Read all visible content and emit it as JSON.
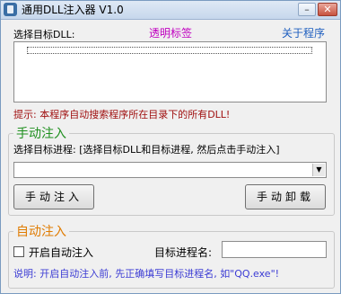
{
  "window": {
    "title": "通用DLL注入器 V1.0",
    "minimize_glyph": "–",
    "close_glyph": "✕"
  },
  "dll_section": {
    "label": "选择目标DLL:",
    "transparent_tag": "透明标签",
    "about_link": "关于程序",
    "hint": "提示: 本程序自动搜索程序所在目录下的所有DLL!"
  },
  "manual_inject": {
    "group_title": "手动注入",
    "process_label": "选择目标进程: [选择目标DLL和目标进程, 然后点击手动注入]",
    "process_value": "",
    "inject_button": "手动注入",
    "uninject_button": "手动卸载"
  },
  "auto_inject": {
    "group_title": "自动注入",
    "enable_label": "开启自动注入",
    "enable_checked": false,
    "target_label": "目标进程名:",
    "target_value": "",
    "note": "说明: 开启自动注入前, 先正确填写目标进程名, 如\"QQ.exe\"!"
  },
  "colors": {
    "manual_title": "#1e8f1e",
    "auto_title": "#e07b00",
    "hint_text": "#a01010",
    "note_text": "#3b3bd4",
    "tag_text": "#c000c0",
    "link_text": "#1f5fbf"
  }
}
